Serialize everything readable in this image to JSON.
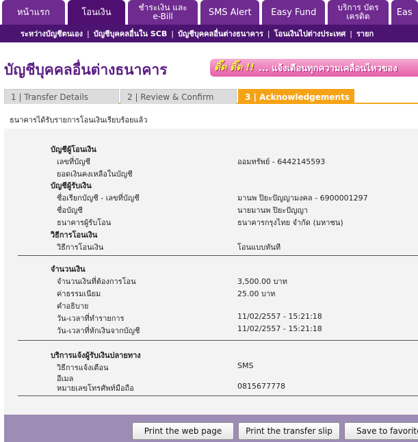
{
  "top_tabs": [
    {
      "label": "หน้าแรก"
    },
    {
      "label": "โอนเงิน"
    },
    {
      "label": "ชำระเงิน และ e-Bill"
    },
    {
      "label": "SMS Alert"
    },
    {
      "label": "Easy Fund"
    },
    {
      "label": "บริการ บัตรเครดิต"
    },
    {
      "label": "Eas"
    }
  ],
  "subnav": [
    {
      "label": "ระหว่างบัญชีตนเอง"
    },
    {
      "label": "บัญชีบุคคลอื่นใน SCB"
    },
    {
      "label": "บัญชีบุคคลอื่นต่างธนาคาร"
    },
    {
      "label": "โอนเงินไปต่างประเทศ"
    },
    {
      "label": "รายก"
    }
  ],
  "page_title": "บัญชีบุคคลอื่นต่างธนาคาร",
  "banner": {
    "tag": "ติ๊ด ติ๊ด !!",
    "text": "... แจ้งเตือนทุกความเคลื่อนไหวของ"
  },
  "steps": [
    {
      "label": "1 | Transfer Details"
    },
    {
      "label": "2 | Review & Confirm"
    },
    {
      "label": "3 | Acknowledgements"
    }
  ],
  "status_message": "ธนาคารได้รับรายการโอนเงินเรียบร้อยแล้ว",
  "from_account": {
    "heading": "บัญชีผู้โอนเงิน",
    "account_no_label": "เลขที่บัญชี",
    "account_no_value": "ออมทรัพย์ - 6442145593",
    "balance_label": "ยอดเงินคงเหลือในบัญชี",
    "balance_value": ""
  },
  "to_account": {
    "heading": "บัญชีผู้รับเงิน",
    "nickname_label": "ชื่อเรียกบัญชี - เลขที่บัญชี",
    "nickname_value": "มานพ ปิยะปัญญามงคล - 6900001297",
    "name_label": "ชื่อบัญชี",
    "name_value": "นายมานพ ปิยะปัญญา",
    "bank_label": "ธนาคารผู้รับโอน",
    "bank_value": "ธนาคารกรุงไทย จำกัด (มหาชน)"
  },
  "method": {
    "heading": "วิธีการโอนเงิน",
    "label": "วิธีการโอนเงิน",
    "value": "โอนแบบทันที"
  },
  "amount": {
    "heading": "จำนวนเงิน",
    "amount_label": "จำนวนเงินที่ต้องการโอน",
    "amount_value": "3,500.00 บาท",
    "fee_label": "ค่าธรรมเนียม",
    "fee_value": "25.00  บาท",
    "desc_label": "คำอธิบาย",
    "desc_value": "",
    "txn_time_label": "วัน-เวลาที่ทำรายการ",
    "txn_time_value": "11/02/2557 - 15:21:18",
    "debit_time_label": "วัน-เวลาที่หักเงินจากบัญชี",
    "debit_time_value": "11/02/2557 - 15:21:18"
  },
  "notify": {
    "heading": "บริการแจ้งผู้รับเงินปลายทาง",
    "method_label": "วิธีการแจ้งเตือน",
    "method_value": "SMS",
    "email_label": "อีเมล",
    "email_value": "",
    "mobile_label": "หมายเลขโทรศัพท์มือถือ",
    "mobile_value": "0815677778"
  },
  "buttons": {
    "print_web": "Print the web page",
    "print_slip": "Print the transfer slip",
    "save_fav": "Save to favorite"
  }
}
